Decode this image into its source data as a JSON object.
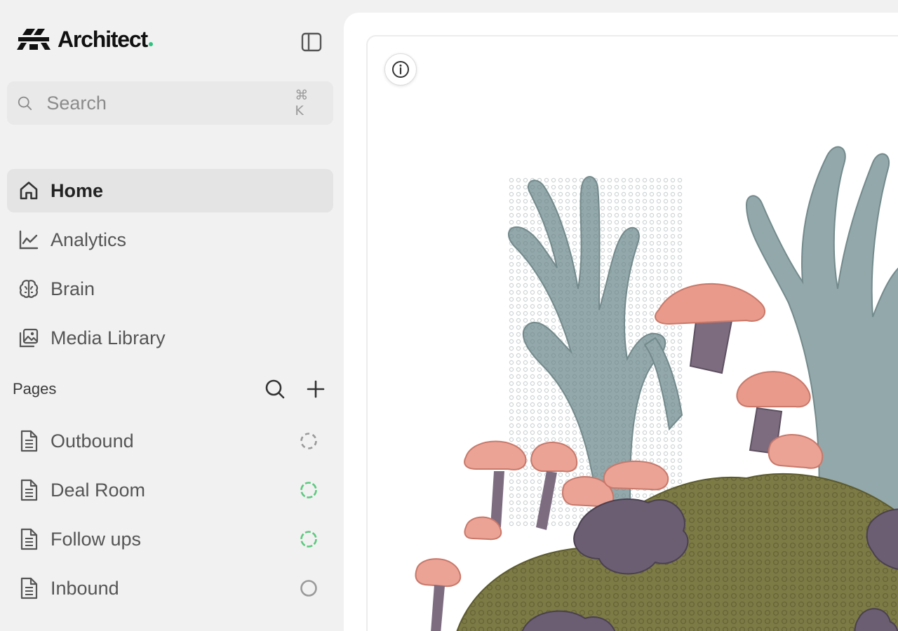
{
  "app": {
    "name": "Architect",
    "brand_dot_color": "#2ec27e"
  },
  "sidebar": {
    "collapse_icon": "sidebar-toggle-icon",
    "search": {
      "placeholder": "Search",
      "shortcut": "⌘ K"
    },
    "nav": [
      {
        "label": "Home",
        "icon": "home-icon",
        "active": true
      },
      {
        "label": "Analytics",
        "icon": "chart-line-icon",
        "active": false
      },
      {
        "label": "Brain",
        "icon": "brain-icon",
        "active": false
      },
      {
        "label": "Media Library",
        "icon": "media-library-icon",
        "active": false
      }
    ],
    "pages": {
      "title": "Pages",
      "items": [
        {
          "label": "Outbound",
          "icon": "document-icon",
          "status": "dashed-gray"
        },
        {
          "label": "Deal Room",
          "icon": "document-icon",
          "status": "dashed-green"
        },
        {
          "label": "Follow ups",
          "icon": "document-icon",
          "status": "dashed-green"
        },
        {
          "label": "Inbound",
          "icon": "document-icon",
          "status": "circle-gray"
        }
      ]
    }
  },
  "main": {
    "info_icon": "info-icon",
    "image_subject": "coral-illustration"
  },
  "colors": {
    "status_green": "#5cc97e",
    "status_gray": "#9a9a9a",
    "coral_teal": "#8fa3a5",
    "coral_pink": "#e9998a",
    "coral_olive": "#7c7a45",
    "coral_purple": "#6b5e72"
  }
}
